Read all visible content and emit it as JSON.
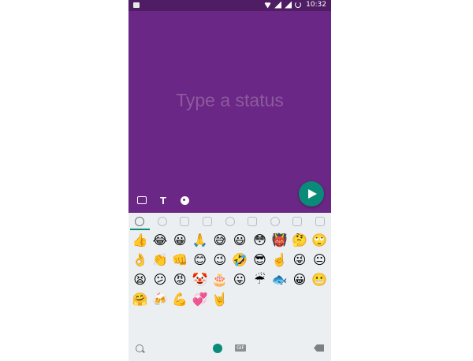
{
  "statusbar": {
    "time": "10:32"
  },
  "composer": {
    "placeholder": "Type a status"
  },
  "tools": [
    {
      "icon": "emoji-keyboard-icon"
    },
    {
      "icon": "text-style-icon",
      "label": "T"
    },
    {
      "icon": "palette-icon"
    }
  ],
  "send": {
    "icon": "send-icon"
  },
  "keyboard": {
    "tabs": [
      "recent",
      "smileys",
      "animals",
      "food",
      "activity",
      "travel",
      "objects",
      "symbols",
      "flags"
    ],
    "active_tab": "recent",
    "emoji_rows": [
      [
        "👍",
        "😂",
        "😀",
        "🙏",
        "😅",
        "😃",
        "😳",
        "👹",
        "🤔",
        "🙄"
      ],
      [
        "👌",
        "👏",
        "👊",
        "😊",
        "😉",
        "🤣",
        "😎",
        "☝️",
        "😜",
        "😐"
      ],
      [
        "😫",
        "😕",
        "😡",
        "🤡",
        "🎂",
        "😛",
        "☔",
        "🐟",
        "😀",
        "😬"
      ],
      [
        "🤗",
        "🍻",
        "💪",
        "💞",
        "🤘"
      ]
    ],
    "gif_label": "GIF"
  }
}
